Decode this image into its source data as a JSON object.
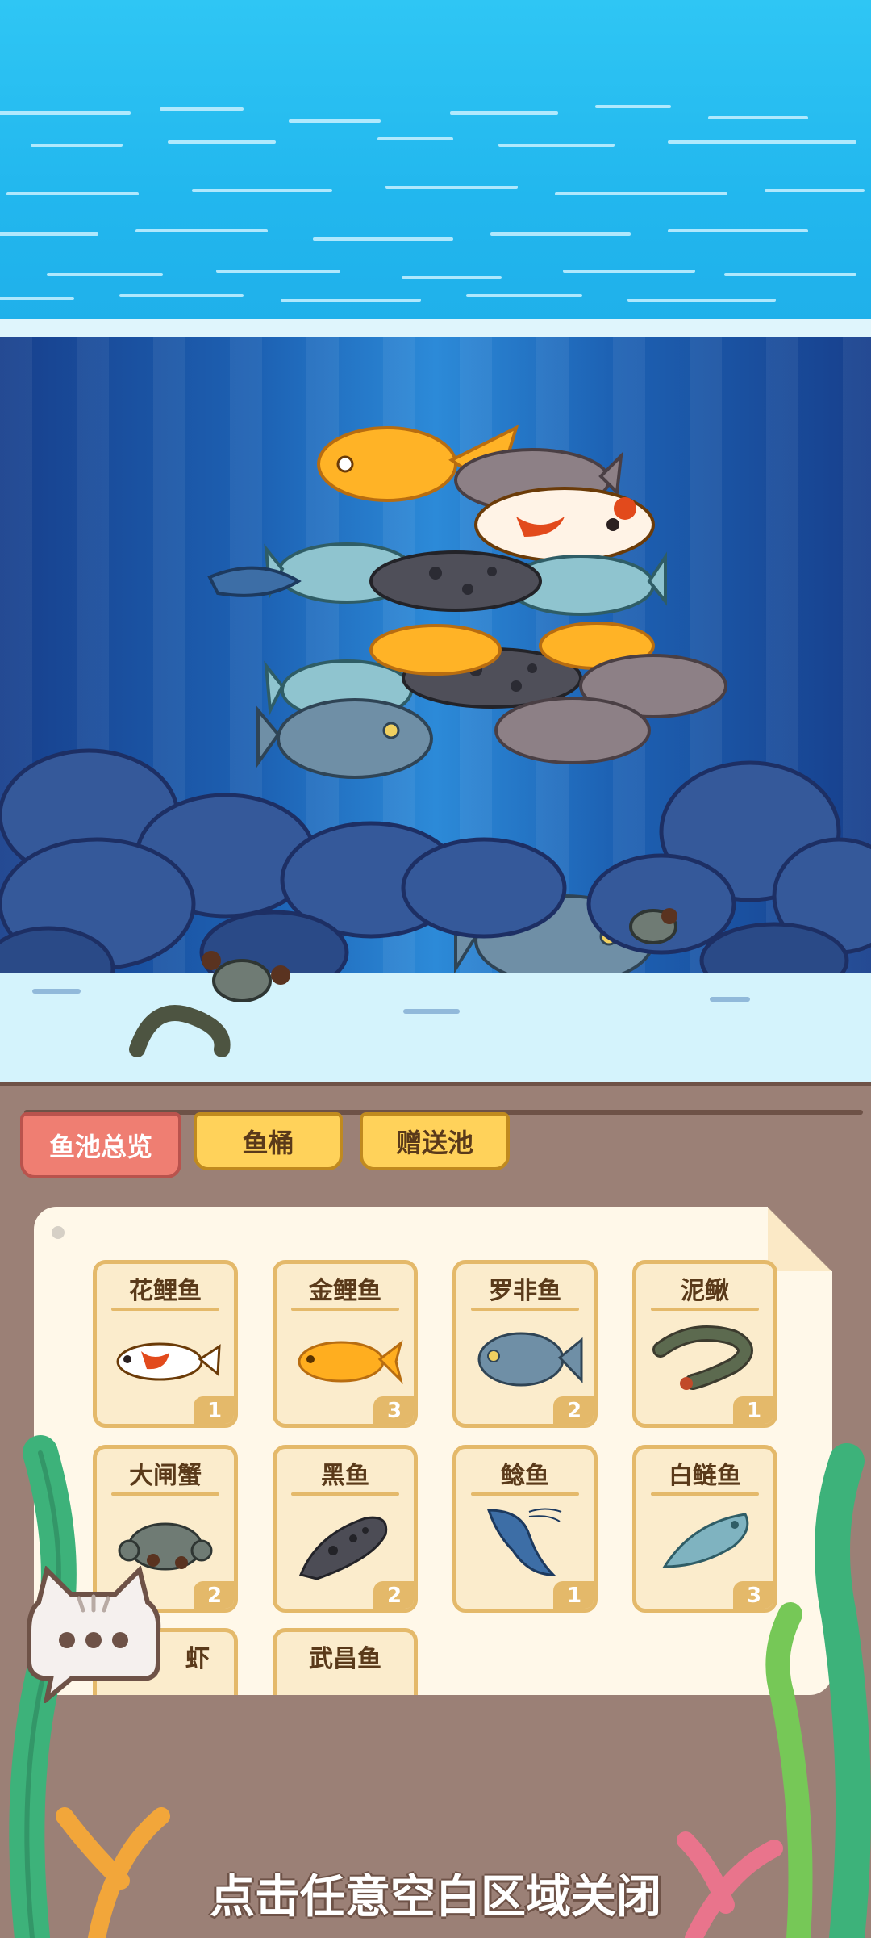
{
  "tabs": [
    {
      "label": "鱼池总览",
      "active": true
    },
    {
      "label": "鱼桶",
      "active": false
    },
    {
      "label": "赠送池",
      "active": false
    }
  ],
  "fish_grid": [
    {
      "name": "花鲤鱼",
      "count": "1",
      "icon": "koi-fish-icon",
      "color": "#ffffff"
    },
    {
      "name": "金鲤鱼",
      "count": "3",
      "icon": "goldfish-icon",
      "color": "#ffae1f"
    },
    {
      "name": "罗非鱼",
      "count": "2",
      "icon": "tilapia-icon",
      "color": "#6f8fa6"
    },
    {
      "name": "泥鳅",
      "count": "1",
      "icon": "loach-icon",
      "color": "#5c6a4f"
    },
    {
      "name": "大闸蟹",
      "count": "2",
      "icon": "crab-icon",
      "color": "#6f7b74"
    },
    {
      "name": "黑鱼",
      "count": "2",
      "icon": "snakehead-icon",
      "color": "#4c4c55"
    },
    {
      "name": "鲶鱼",
      "count": "1",
      "icon": "catfish-icon",
      "color": "#3d6ea6"
    },
    {
      "name": "白鲢鱼",
      "count": "3",
      "icon": "silver-carp-icon",
      "color": "#7fb3c0"
    },
    {
      "name": "虾",
      "count": "",
      "icon": "shrimp-icon",
      "color": "#d88a5a"
    },
    {
      "name": "武昌鱼",
      "count": "",
      "icon": "bream-icon",
      "color": "#8c8c95"
    }
  ],
  "close_hint": "点击任意空白区域关闭",
  "colors": {
    "active_tab": "#ef7e72",
    "tab": "#ffd25a",
    "panel": "#9b8076",
    "card": "#fff8e9"
  }
}
